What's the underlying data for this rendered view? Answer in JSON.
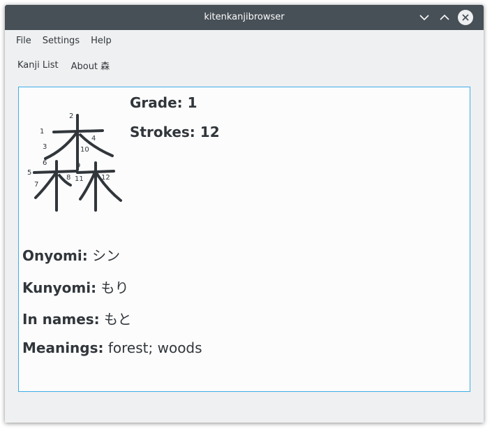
{
  "window": {
    "title": "kitenkanjibrowser"
  },
  "menu": [
    "File",
    "Settings",
    "Help"
  ],
  "tabs": [
    "Kanji List",
    "About 森"
  ],
  "kanji": {
    "character": "森",
    "stroke_numbers": [
      "1",
      "2",
      "3",
      "4",
      "5",
      "6",
      "7",
      "8",
      "9",
      "10",
      "11",
      "12"
    ],
    "grade_label": "Grade:",
    "grade_value": "1",
    "strokes_label": "Strokes:",
    "strokes_value": "12",
    "onyomi_label": "Onyomi:",
    "onyomi_value": "シン",
    "kunyomi_label": "Kunyomi:",
    "kunyomi_value": "もり",
    "names_label": "In names:",
    "names_value": "もと",
    "meanings_label": "Meanings:",
    "meanings_value": "forest; woods"
  },
  "icons": {
    "minimize": "chevron-down-icon",
    "maximize": "chevron-up-icon",
    "close": "close-icon"
  },
  "colors": {
    "titlebar": "#475057",
    "accent": "#3daee9",
    "text": "#31363b",
    "background": "#eff0f1"
  }
}
